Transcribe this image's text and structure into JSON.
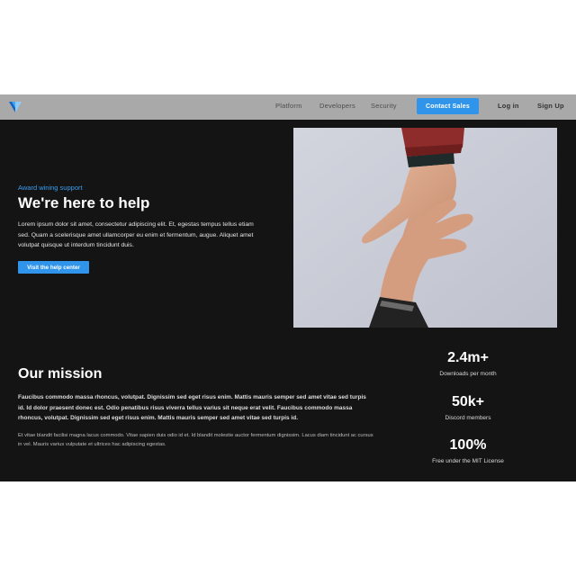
{
  "nav": {
    "links": [
      "Platform",
      "Developers",
      "Security"
    ],
    "contact_label": "Contact Sales",
    "login_label": "Log in",
    "signup_label": "Sign Up",
    "logo_icon": "v-logo-icon"
  },
  "hero": {
    "eyebrow": "Award wining support",
    "title": "We're here to help",
    "text": "Lorem ipsum dolor sit amet, consectetur adipiscing elit. Et, egestas tempus tellus etiam sed. Quam a scelerisque amet ullamcorper eu enim et fermentum, augue. Aliquet amet volutpat quisque ut interdum tincidunt duis.",
    "button_label": "Visit the help center",
    "image": "hands-reaching-image"
  },
  "mission": {
    "title": "Our mission",
    "text_bold": "Faucibus commodo massa rhoncus, volutpat. Dignissim sed eget risus enim. Mattis mauris semper sed amet vitae sed turpis id. Id dolor praesent donec est. Odio penatibus risus viverra tellus varius sit neque erat velit. Faucibus commodo massa rhoncus, volutpat. Dignissim sed eget risus enim. Mattis mauris semper sed amet vitae sed turpis id.",
    "text_small": "Et vitae blandit facilisi magna lacus commodo. Vitae sapien duis odio id et. Id blandit molestie auctor fermentum dignissim. Lacus diam tincidunt ac cursus in vel. Mauris varius vulputate et ultrices hac adipiscing egestas."
  },
  "stats": [
    {
      "value": "2.4m+",
      "label": "Downloads per month"
    },
    {
      "value": "50k+",
      "label": "Discord members"
    },
    {
      "value": "100%",
      "label": "Free under the MIT License"
    }
  ],
  "colors": {
    "accent": "#2f94ea",
    "nav_bg": "#a9a9a9",
    "page_bg": "#141414"
  }
}
